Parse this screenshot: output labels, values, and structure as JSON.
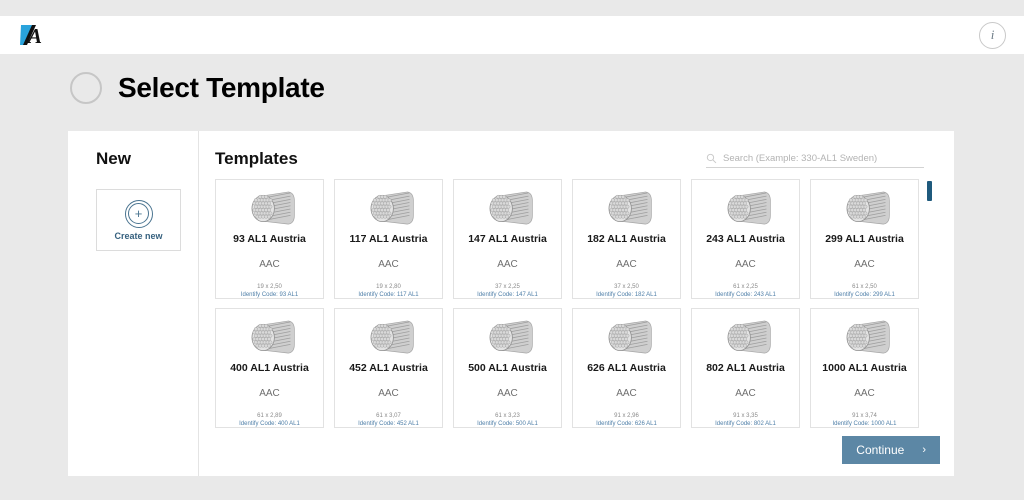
{
  "topbar": {
    "logo_name": "brand-logo",
    "info_label": "i"
  },
  "header": {
    "title": "Select Template"
  },
  "new_panel": {
    "title": "New",
    "create_label": "Create new",
    "plus_glyph": "+"
  },
  "templates_panel": {
    "title": "Templates",
    "search_placeholder": "Search (Example: 330-AL1 Sweden)",
    "search_value": ""
  },
  "footer": {
    "continue_label": "Continue",
    "chevron": "›"
  },
  "colors": {
    "accent_blue": "#35607e",
    "button_blue": "#5c87a5",
    "scrollbar": "#1f5a7d",
    "code_text": "#4f7fa8",
    "logo_blue": "#29a3dc"
  },
  "templates": [
    {
      "name": "93 AL1 Austria",
      "type": "AAC",
      "dimension": "19 x 2,50",
      "code": "Identify Code: 93 AL1"
    },
    {
      "name": "117 AL1 Austria",
      "type": "AAC",
      "dimension": "19 x 2,80",
      "code": "Identify Code: 117 AL1"
    },
    {
      "name": "147 AL1 Austria",
      "type": "AAC",
      "dimension": "37 x 2,25",
      "code": "Identify Code: 147 AL1"
    },
    {
      "name": "182 AL1 Austria",
      "type": "AAC",
      "dimension": "37 x 2,50",
      "code": "Identify Code: 182 AL1"
    },
    {
      "name": "243 AL1 Austria",
      "type": "AAC",
      "dimension": "61 x 2,25",
      "code": "Identify Code: 243 AL1"
    },
    {
      "name": "299 AL1 Austria",
      "type": "AAC",
      "dimension": "61 x 2,50",
      "code": "Identify Code: 299 AL1"
    },
    {
      "name": "400 AL1 Austria",
      "type": "AAC",
      "dimension": "61 x 2,89",
      "code": "Identify Code: 400 AL1"
    },
    {
      "name": "452 AL1 Austria",
      "type": "AAC",
      "dimension": "61 x 3,07",
      "code": "Identify Code: 452 AL1"
    },
    {
      "name": "500 AL1 Austria",
      "type": "AAC",
      "dimension": "61 x 3,23",
      "code": "Identify Code: 500 AL1"
    },
    {
      "name": "626 AL1 Austria",
      "type": "AAC",
      "dimension": "91 x 2,96",
      "code": "Identify Code: 626 AL1"
    },
    {
      "name": "802 AL1 Austria",
      "type": "AAC",
      "dimension": "91 x 3,35",
      "code": "Identify Code: 802 AL1"
    },
    {
      "name": "1000 AL1 Austria",
      "type": "AAC",
      "dimension": "91 x 3,74",
      "code": "Identify Code: 1000 AL1"
    }
  ]
}
